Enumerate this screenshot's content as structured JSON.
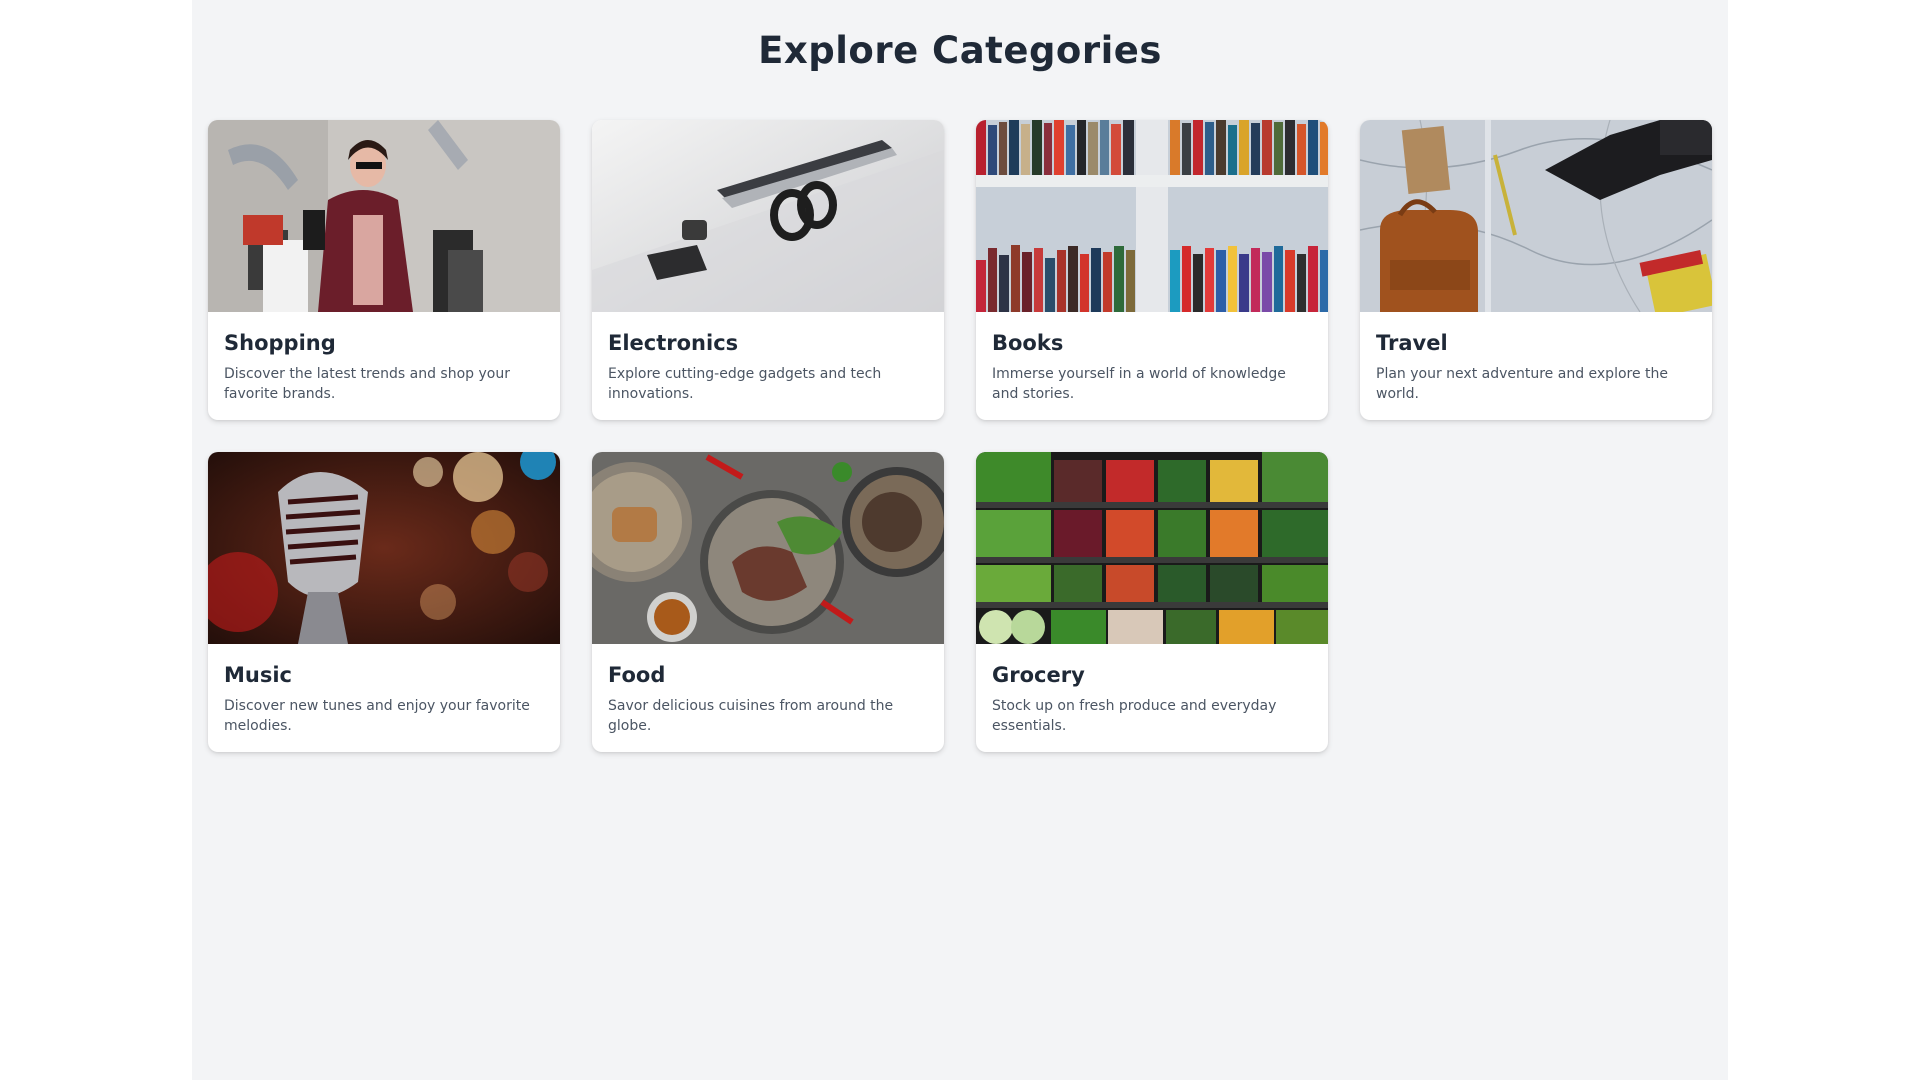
{
  "page": {
    "title": "Explore Categories"
  },
  "categories": [
    {
      "title": "Shopping",
      "description": "Discover the latest trends and shop your favorite brands.",
      "image": "woman-with-shopping-bags"
    },
    {
      "title": "Electronics",
      "description": "Explore cutting-edge gadgets and tech innovations.",
      "image": "laptop-headphones-phone-watch"
    },
    {
      "title": "Books",
      "description": "Immerse yourself in a world of knowledge and stories.",
      "image": "bookshelf"
    },
    {
      "title": "Travel",
      "description": "Plan your next adventure and explore the world.",
      "image": "map-camera-backpack"
    },
    {
      "title": "Music",
      "description": "Discover new tunes and enjoy your favorite melodies.",
      "image": "vintage-microphone"
    },
    {
      "title": "Food",
      "description": "Savor delicious cuisines from around the globe.",
      "image": "plated-dishes"
    },
    {
      "title": "Grocery",
      "description": "Stock up on fresh produce and everyday essentials.",
      "image": "produce-shelves"
    }
  ],
  "colors": {
    "background": "#f3f4f6",
    "title": "#1f2937",
    "description": "#4b5563",
    "card": "#ffffff"
  }
}
